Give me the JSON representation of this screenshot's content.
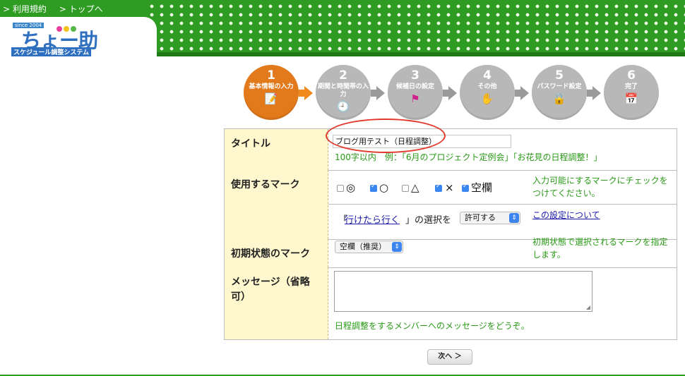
{
  "header": {
    "links": [
      "> 利用規約",
      "> トップへ"
    ],
    "logo": {
      "since": "since 2004",
      "name": "ちょー助",
      "subtitle": "スケジュール調整システム"
    }
  },
  "steps": [
    {
      "num": "1",
      "label": "基本情報の入力",
      "icon": "notepad-pencil-icon",
      "active": true
    },
    {
      "num": "2",
      "label": "期間と時間帯の入力",
      "icon": "clock-icon",
      "active": false
    },
    {
      "num": "3",
      "label": "候補日の設定",
      "icon": "flag-icon",
      "active": false
    },
    {
      "num": "4",
      "label": "その他",
      "icon": "glove-icon",
      "active": false
    },
    {
      "num": "5",
      "label": "パスワード設定",
      "icon": "padlock-icon",
      "active": false
    },
    {
      "num": "6",
      "label": "完了",
      "icon": "calendar-check-icon",
      "active": false
    }
  ],
  "form": {
    "title": {
      "label": "タイトル",
      "value": "ブログ用テスト（日程調整）",
      "hint": "100字以内　例：「6月のプロジェクト定例会」「お花見の日程調整！」"
    },
    "marks": {
      "label": "使用するマーク",
      "options": [
        {
          "symbol": "◎",
          "checked": false
        },
        {
          "symbol": "○",
          "checked": true
        },
        {
          "symbol": "△",
          "checked": false
        },
        {
          "symbol": "×",
          "checked": true
        },
        {
          "symbol": "空欄",
          "checked": true
        }
      ],
      "note": "入力可能にするマークにチェックをつけてください。",
      "ikitara_prefix": "「",
      "ikitara_link": "行けたら行く",
      "ikitara_suffix": "」の選択を",
      "ikitara_select": "許可する",
      "settings_link": "この設定について"
    },
    "initial_mark": {
      "label": "初期状態のマーク",
      "select": "空欄（推奨）",
      "note": "初期状態で選択されるマークを指定します。"
    },
    "message": {
      "label": "メッセージ（省略可）",
      "value": "",
      "hint": "日程調整をするメンバーへのメッセージをどうぞ。"
    }
  },
  "next_button": "次へ ＞",
  "colors": {
    "header_green": "#2e9b22",
    "active_step": "#e2791a",
    "inactive_step": "#b8b8b8",
    "label_bg": "#fff8cf",
    "hint_green": "#2a9a17",
    "highlight_red": "#e0392b"
  }
}
